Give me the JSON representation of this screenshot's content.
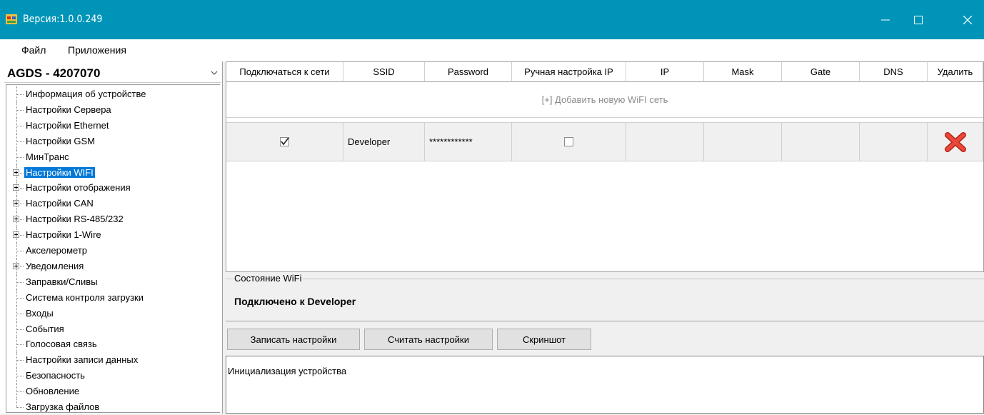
{
  "window": {
    "title": "Версия:1.0.0.249"
  },
  "menu": {
    "file": "Файл",
    "apps": "Приложения"
  },
  "device": {
    "selected": "AGDS - 4207070"
  },
  "tree": [
    {
      "label": "Информация об устройстве",
      "expandable": false
    },
    {
      "label": "Настройки Сервера",
      "expandable": false
    },
    {
      "label": "Настройки Ethernet",
      "expandable": false
    },
    {
      "label": "Настройки GSM",
      "expandable": false
    },
    {
      "label": "МинТранс",
      "expandable": false
    },
    {
      "label": "Настройки WIFI",
      "expandable": true,
      "selected": true
    },
    {
      "label": "Настройки отображения",
      "expandable": true
    },
    {
      "label": "Настройки CAN",
      "expandable": true
    },
    {
      "label": "Настройки RS-485/232",
      "expandable": true
    },
    {
      "label": "Настройки 1-Wire",
      "expandable": true
    },
    {
      "label": "Акселерометр",
      "expandable": false
    },
    {
      "label": "Уведомления",
      "expandable": true
    },
    {
      "label": "Заправки/Сливы",
      "expandable": false
    },
    {
      "label": "Система контроля загрузки",
      "expandable": false
    },
    {
      "label": "Входы",
      "expandable": false
    },
    {
      "label": "События",
      "expandable": false
    },
    {
      "label": "Голосовая связь",
      "expandable": false
    },
    {
      "label": "Настройки записи данных",
      "expandable": false
    },
    {
      "label": "Безопасность",
      "expandable": false
    },
    {
      "label": "Обновление",
      "expandable": false
    },
    {
      "label": "Загрузка файлов",
      "expandable": false
    }
  ],
  "grid": {
    "columns": [
      "Подключаться к сети",
      "SSID",
      "Password",
      "Ручная настройка IP",
      "IP",
      "Mask",
      "Gate",
      "DNS",
      "Удалить"
    ],
    "add_row": "[+] Добавить новую WiFI сеть",
    "rows": [
      {
        "connect": true,
        "ssid": "Developer",
        "password": "************",
        "manual_ip": false,
        "ip": "",
        "mask": "",
        "gate": "",
        "dns": ""
      }
    ]
  },
  "wifi_state": {
    "legend": "Состояние WiFi",
    "status": "Подключено к Developer"
  },
  "buttons": {
    "write": "Записать настройки",
    "read": "Считать настройки",
    "screenshot": "Скриншот"
  },
  "log": {
    "text": "Инициализация устройства"
  },
  "colors": {
    "titlebar": "#0095b8",
    "selection": "#0078d7",
    "delete_icon": "#e23b2e"
  }
}
